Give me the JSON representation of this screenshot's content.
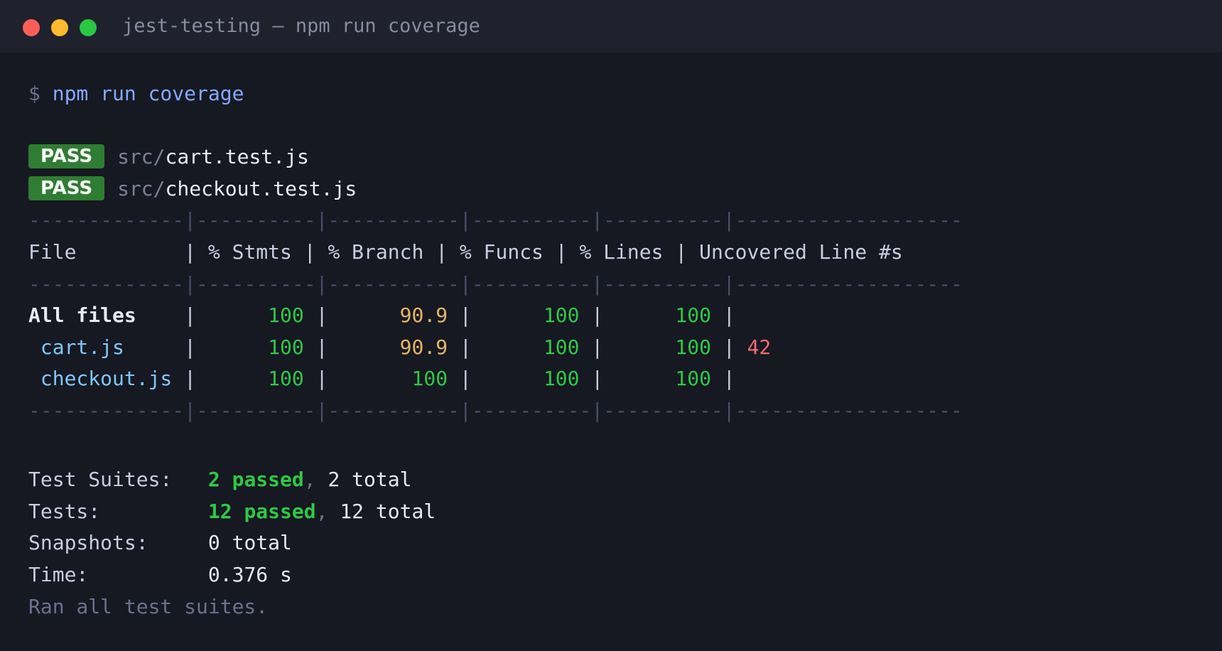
{
  "window": {
    "title": "jest-testing — npm run coverage"
  },
  "prompt": {
    "symbol": "$",
    "command": "npm run coverage"
  },
  "results": [
    {
      "status": "PASS",
      "dir": "src/",
      "file": "cart.test.js"
    },
    {
      "status": "PASS",
      "dir": "src/",
      "file": "checkout.test.js"
    }
  ],
  "coverage": {
    "separator": "-------------|----------|-----------|----------|----------|-------------------",
    "headers": [
      "File",
      "% Stmts",
      "% Branch",
      "% Funcs",
      "% Lines",
      "Uncovered Line #s"
    ],
    "rows": [
      {
        "file": "All files",
        "stmts": "100",
        "branch": "90.9",
        "funcs": "100",
        "lines": "100",
        "uncovered": ""
      },
      {
        "file": "cart.js",
        "stmts": "100",
        "branch": "90.9",
        "funcs": "100",
        "lines": "100",
        "uncovered": "42"
      },
      {
        "file": "checkout.js",
        "stmts": "100",
        "branch": "100",
        "funcs": "100",
        "lines": "100",
        "uncovered": ""
      }
    ]
  },
  "summary": {
    "suites": {
      "label": "Test Suites:",
      "passed": "2 passed",
      "comma": ",",
      "total": "2 total"
    },
    "tests": {
      "label": "Tests:",
      "passed": "12 passed",
      "comma": ",",
      "total": "12 total"
    },
    "snapshots": {
      "label": "Snapshots:",
      "value": "0 total"
    },
    "time": {
      "label": "Time:",
      "value": "0.376 s"
    },
    "footer": "Ran all test suites."
  },
  "colors": {
    "background": "#161822",
    "titlebar": "#1f212d",
    "pass_badge": "#2f7d32",
    "success": "#2ec944",
    "warning": "#e5b567",
    "error": "#ef6b6b",
    "file": "#7fc8ff",
    "command": "#82aaff"
  }
}
